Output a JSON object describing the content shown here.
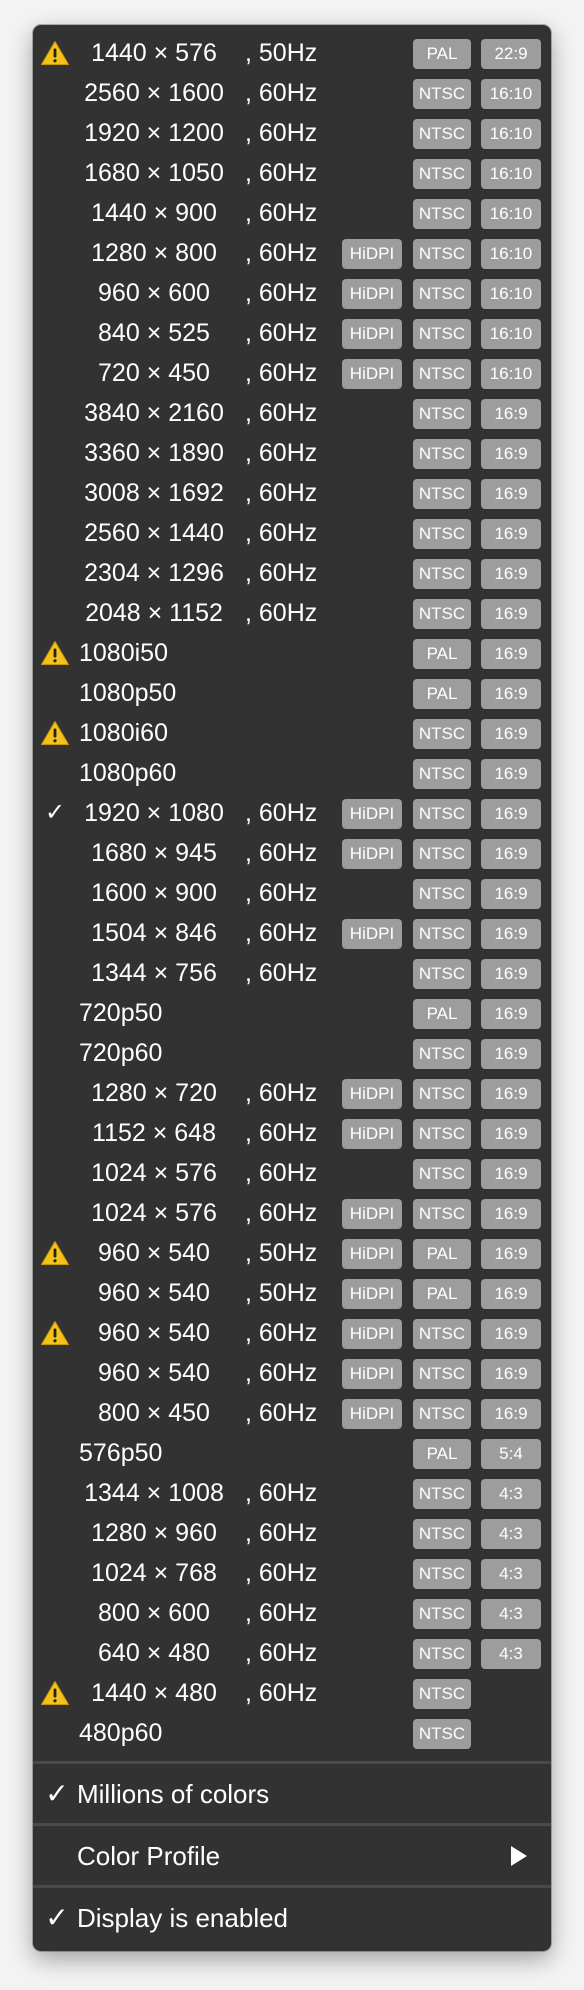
{
  "icons": {
    "warning": "warning-icon",
    "check": "checkmark-icon",
    "submenu": "submenu-arrow-icon"
  },
  "colors": {
    "menu_background": "#323232",
    "badge_background": "#9d9d9d",
    "text": "#ffffff",
    "warning": "#f4c21a"
  },
  "modes": [
    {
      "mark": "warning",
      "res": "1440 × 576",
      "hz": ", 50Hz",
      "hidpi": "",
      "signal": "PAL",
      "aspect": "22:9"
    },
    {
      "mark": "",
      "res": "2560 × 1600",
      "hz": ", 60Hz",
      "hidpi": "",
      "signal": "NTSC",
      "aspect": "16:10"
    },
    {
      "mark": "",
      "res": "1920 × 1200",
      "hz": ", 60Hz",
      "hidpi": "",
      "signal": "NTSC",
      "aspect": "16:10"
    },
    {
      "mark": "",
      "res": "1680 × 1050",
      "hz": ", 60Hz",
      "hidpi": "",
      "signal": "NTSC",
      "aspect": "16:10"
    },
    {
      "mark": "",
      "res": "1440 × 900",
      "hz": ", 60Hz",
      "hidpi": "",
      "signal": "NTSC",
      "aspect": "16:10"
    },
    {
      "mark": "",
      "res": "1280 × 800",
      "hz": ", 60Hz",
      "hidpi": "HiDPI",
      "signal": "NTSC",
      "aspect": "16:10"
    },
    {
      "mark": "",
      "res": "960 × 600",
      "hz": ", 60Hz",
      "hidpi": "HiDPI",
      "signal": "NTSC",
      "aspect": "16:10"
    },
    {
      "mark": "",
      "res": "840 × 525",
      "hz": ", 60Hz",
      "hidpi": "HiDPI",
      "signal": "NTSC",
      "aspect": "16:10"
    },
    {
      "mark": "",
      "res": "720 × 450",
      "hz": ", 60Hz",
      "hidpi": "HiDPI",
      "signal": "NTSC",
      "aspect": "16:10"
    },
    {
      "mark": "",
      "res": "3840 × 2160",
      "hz": ", 60Hz",
      "hidpi": "",
      "signal": "NTSC",
      "aspect": "16:9"
    },
    {
      "mark": "",
      "res": "3360 × 1890",
      "hz": ", 60Hz",
      "hidpi": "",
      "signal": "NTSC",
      "aspect": "16:9"
    },
    {
      "mark": "",
      "res": "3008 × 1692",
      "hz": ", 60Hz",
      "hidpi": "",
      "signal": "NTSC",
      "aspect": "16:9"
    },
    {
      "mark": "",
      "res": "2560 × 1440",
      "hz": ", 60Hz",
      "hidpi": "",
      "signal": "NTSC",
      "aspect": "16:9"
    },
    {
      "mark": "",
      "res": "2304 × 1296",
      "hz": ", 60Hz",
      "hidpi": "",
      "signal": "NTSC",
      "aspect": "16:9"
    },
    {
      "mark": "",
      "res": "2048 × 1152",
      "hz": ", 60Hz",
      "hidpi": "",
      "signal": "NTSC",
      "aspect": "16:9"
    },
    {
      "mark": "warning",
      "res": "1080i50",
      "hz": "",
      "hidpi": "",
      "signal": "PAL",
      "aspect": "16:9"
    },
    {
      "mark": "",
      "res": "1080p50",
      "hz": "",
      "hidpi": "",
      "signal": "PAL",
      "aspect": "16:9"
    },
    {
      "mark": "warning",
      "res": "1080i60",
      "hz": "",
      "hidpi": "",
      "signal": "NTSC",
      "aspect": "16:9"
    },
    {
      "mark": "",
      "res": "1080p60",
      "hz": "",
      "hidpi": "",
      "signal": "NTSC",
      "aspect": "16:9"
    },
    {
      "mark": "check",
      "res": "1920 × 1080",
      "hz": ", 60Hz",
      "hidpi": "HiDPI",
      "signal": "NTSC",
      "aspect": "16:9"
    },
    {
      "mark": "",
      "res": "1680 × 945",
      "hz": ", 60Hz",
      "hidpi": "HiDPI",
      "signal": "NTSC",
      "aspect": "16:9"
    },
    {
      "mark": "",
      "res": "1600 × 900",
      "hz": ", 60Hz",
      "hidpi": "",
      "signal": "NTSC",
      "aspect": "16:9"
    },
    {
      "mark": "",
      "res": "1504 × 846",
      "hz": ", 60Hz",
      "hidpi": "HiDPI",
      "signal": "NTSC",
      "aspect": "16:9"
    },
    {
      "mark": "",
      "res": "1344 × 756",
      "hz": ", 60Hz",
      "hidpi": "",
      "signal": "NTSC",
      "aspect": "16:9"
    },
    {
      "mark": "",
      "res": "720p50",
      "hz": "",
      "hidpi": "",
      "signal": "PAL",
      "aspect": "16:9"
    },
    {
      "mark": "",
      "res": "720p60",
      "hz": "",
      "hidpi": "",
      "signal": "NTSC",
      "aspect": "16:9"
    },
    {
      "mark": "",
      "res": "1280 × 720",
      "hz": ", 60Hz",
      "hidpi": "HiDPI",
      "signal": "NTSC",
      "aspect": "16:9"
    },
    {
      "mark": "",
      "res": "1152 × 648",
      "hz": ", 60Hz",
      "hidpi": "HiDPI",
      "signal": "NTSC",
      "aspect": "16:9"
    },
    {
      "mark": "",
      "res": "1024 × 576",
      "hz": ", 60Hz",
      "hidpi": "",
      "signal": "NTSC",
      "aspect": "16:9"
    },
    {
      "mark": "",
      "res": "1024 × 576",
      "hz": ", 60Hz",
      "hidpi": "HiDPI",
      "signal": "NTSC",
      "aspect": "16:9"
    },
    {
      "mark": "warning",
      "res": "960 × 540",
      "hz": ", 50Hz",
      "hidpi": "HiDPI",
      "signal": "PAL",
      "aspect": "16:9"
    },
    {
      "mark": "",
      "res": "960 × 540",
      "hz": ", 50Hz",
      "hidpi": "HiDPI",
      "signal": "PAL",
      "aspect": "16:9"
    },
    {
      "mark": "warning",
      "res": "960 × 540",
      "hz": ", 60Hz",
      "hidpi": "HiDPI",
      "signal": "NTSC",
      "aspect": "16:9"
    },
    {
      "mark": "",
      "res": "960 × 540",
      "hz": ", 60Hz",
      "hidpi": "HiDPI",
      "signal": "NTSC",
      "aspect": "16:9"
    },
    {
      "mark": "",
      "res": "800 × 450",
      "hz": ", 60Hz",
      "hidpi": "HiDPI",
      "signal": "NTSC",
      "aspect": "16:9"
    },
    {
      "mark": "",
      "res": "576p50",
      "hz": "",
      "hidpi": "",
      "signal": "PAL",
      "aspect": "5:4"
    },
    {
      "mark": "",
      "res": "1344 × 1008",
      "hz": ", 60Hz",
      "hidpi": "",
      "signal": "NTSC",
      "aspect": "4:3"
    },
    {
      "mark": "",
      "res": "1280 × 960",
      "hz": ", 60Hz",
      "hidpi": "",
      "signal": "NTSC",
      "aspect": "4:3"
    },
    {
      "mark": "",
      "res": "1024 × 768",
      "hz": ", 60Hz",
      "hidpi": "",
      "signal": "NTSC",
      "aspect": "4:3"
    },
    {
      "mark": "",
      "res": "800 × 600",
      "hz": ", 60Hz",
      "hidpi": "",
      "signal": "NTSC",
      "aspect": "4:3"
    },
    {
      "mark": "",
      "res": "640 × 480",
      "hz": ", 60Hz",
      "hidpi": "",
      "signal": "NTSC",
      "aspect": "4:3"
    },
    {
      "mark": "warning",
      "res": "1440 × 480",
      "hz": ", 60Hz",
      "hidpi": "",
      "signal": "NTSC",
      "aspect": ""
    },
    {
      "mark": "",
      "res": "480p60",
      "hz": "",
      "hidpi": "",
      "signal": "NTSC",
      "aspect": ""
    }
  ],
  "options": [
    {
      "checked": true,
      "label": "Millions of colors",
      "submenu": false
    },
    {
      "checked": false,
      "label": "Color Profile",
      "submenu": true
    },
    {
      "checked": true,
      "label": "Display is enabled",
      "submenu": false
    }
  ],
  "check_glyph": "✓"
}
